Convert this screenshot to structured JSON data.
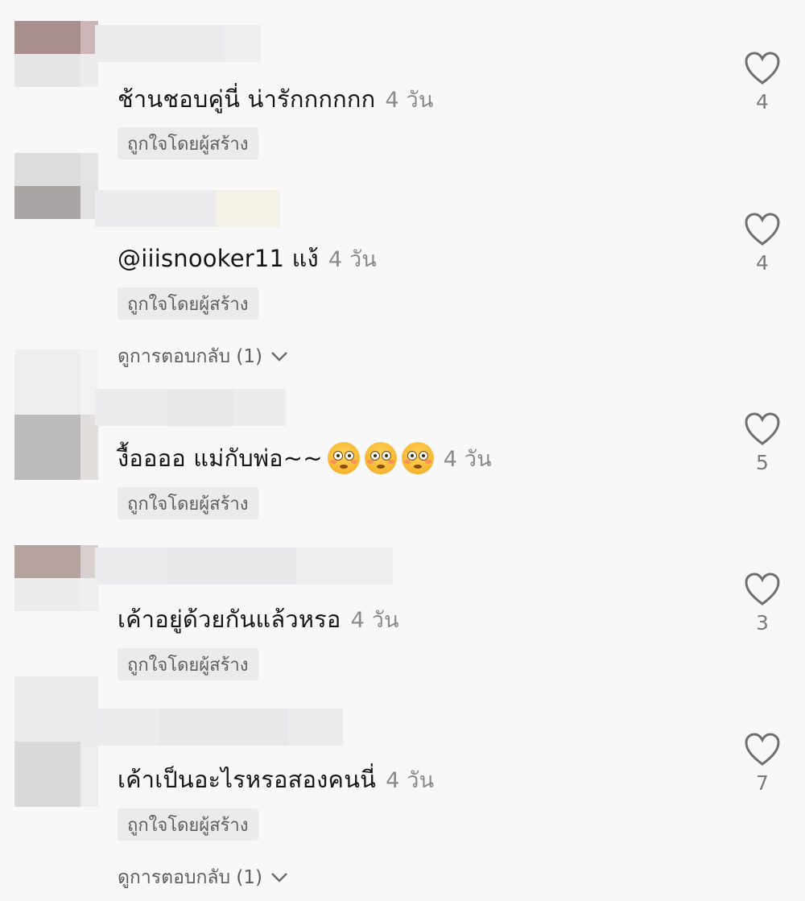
{
  "comments": [
    {
      "text": "ช้านชอบคู่นี่ น่ารักกกกกก",
      "time": "4 วัน",
      "badge": "ถูกใจโดยผู้สร้าง",
      "likes": "4",
      "avatar_colors": [
        "#a98e8e",
        "#cdb6b8",
        "#e6e6e7",
        "#ececed"
      ]
    },
    {
      "text": "@iiisnooker11 แง้",
      "time": "4 วัน",
      "badge": "ถูกใจโดยผู้สร้าง",
      "replies": "ดูการตอบกลับ (1)",
      "likes": "4",
      "avatar_colors": [
        "#dcdcdd",
        "#e4e4e5",
        "#a9a6a5",
        "#e2e2e3"
      ]
    },
    {
      "text": "งื้ออออ แม่กับพ่อ~~",
      "emojis": [
        "flushed-face",
        "flushed-face",
        "flushed-face"
      ],
      "time": "4 วัน",
      "badge": "ถูกใจโดยผู้สร้าง",
      "likes": "5",
      "avatar_colors": [
        "#ededf0",
        "#f2f2f2",
        "#bcbabd",
        "#e2dedd"
      ]
    },
    {
      "text": "เค้าอยู่ด้วยกันแล้วหรอ",
      "time": "4 วัน",
      "badge": "ถูกใจโดยผู้สร้าง",
      "likes": "3",
      "avatar_colors": [
        "#b6a29e",
        "#d9d0cf",
        "#ececed",
        "#efefef"
      ]
    },
    {
      "text": "เค้าเป็นอะไรหรอสองคนนี่",
      "time": "4 วัน",
      "badge": "ถูกใจโดยผู้สร้าง",
      "replies": "ดูการตอบกลับ (1)",
      "likes": "7",
      "avatar_colors": [
        "#dcdcdd",
        "#ececec",
        "#d6d6d7",
        "#ebebeb"
      ]
    }
  ],
  "colors": {
    "text": "#161616",
    "muted": "#8a8a8a",
    "badge_bg": "#ebebeb",
    "heart": "#6f6f6f"
  },
  "icons": {
    "like": "heart-outline-icon",
    "expand": "chevron-down-icon"
  }
}
